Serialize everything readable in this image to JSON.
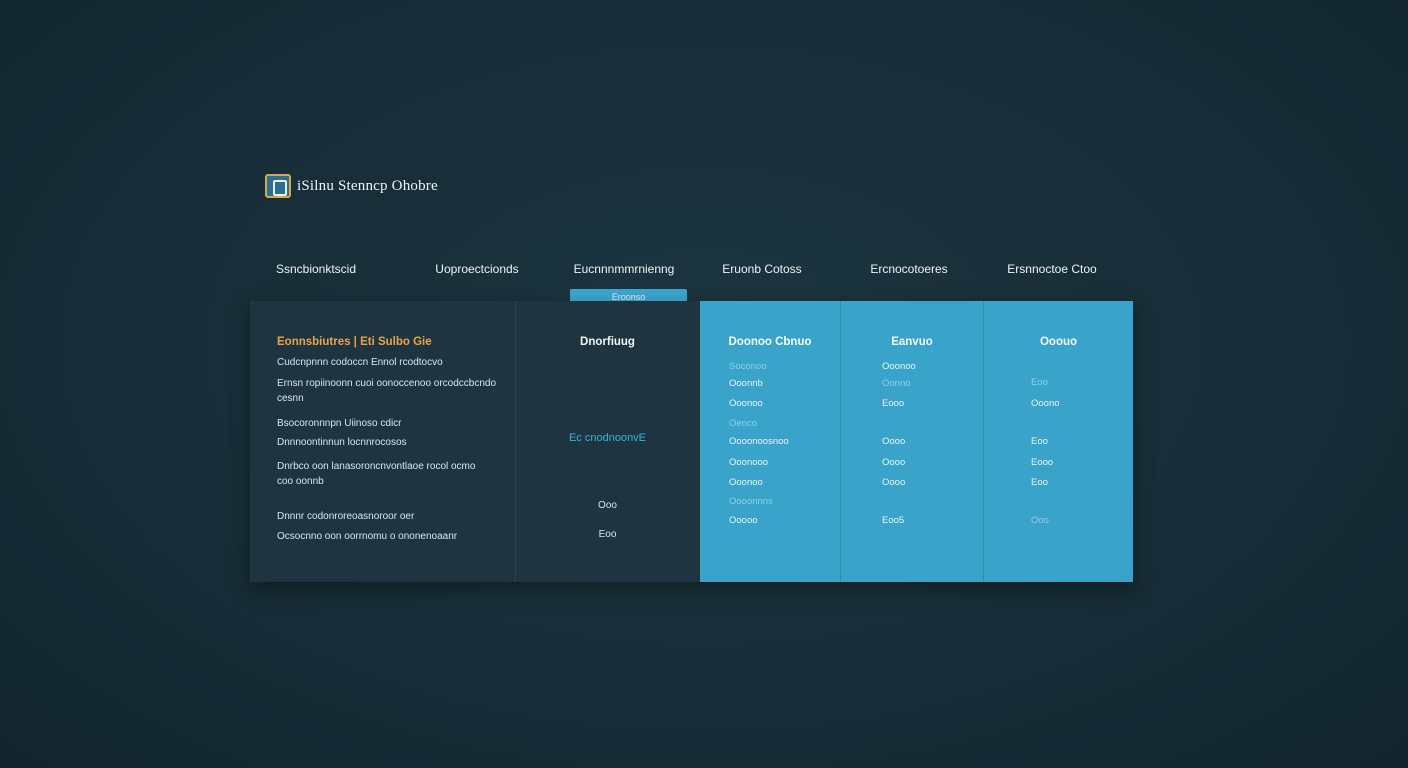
{
  "app": {
    "title": "iSilnu Stenncp Ohobre",
    "logo_icon": "app-logo-icon"
  },
  "tabs": [
    {
      "label": "Ssncbionktscid"
    },
    {
      "label": "Uoproectcionds"
    },
    {
      "label": "Eucnnnmmrnienng"
    },
    {
      "label": "Eruonb Cotoss"
    },
    {
      "label": "Ercnocotoeres"
    },
    {
      "label": "Ersnnoctoe Ctoo"
    }
  ],
  "selected_tab_badge": "Eroonso",
  "features": {
    "heading": "Eonnsbiutres  |  Eti Sulbo Gie",
    "items": [
      "Cudcnpnnn codoccn Ennol rcodtocvo",
      "Ernsn ropiinoonn cuoi oonoccenoo orcodccbcndo cesnn",
      "Bsocoronnnpn Uiinoso  cdicr",
      "Dnnnoontinnun locnnrocosos",
      "Dnrbco oon lanasoroncnvontlaoe rocol ocmo coo oonnb",
      "Dnnnr codonroreoasnoroor oer",
      "Ocsocnno oon oorrnomu o ononenoaanr"
    ]
  },
  "basic_plan": {
    "name": "Dnorfiuug",
    "highlight_prefix": "Ec cnodnoo",
    "highlight_accent": "nvE",
    "value_1": "Ooo",
    "value_2": "Eoo"
  },
  "plans": [
    {
      "name": "Doonoo Cbnuo",
      "cells": [
        {
          "text": "Soconoo",
          "dim": true
        },
        {
          "text": "Ooonnb",
          "dim": false
        },
        {
          "text": "Ooonoo",
          "dim": false
        },
        {
          "text": "Oenco",
          "dim": true
        },
        {
          "text": "Oooonoosnoo",
          "dim": false
        },
        {
          "text": "Ooonooo",
          "dim": false
        },
        {
          "text": "Ooonoo",
          "dim": false
        },
        {
          "text": "Oooonnns",
          "dim": true
        },
        {
          "text": "Ooooo",
          "dim": false
        }
      ]
    },
    {
      "name": "Eanvuo",
      "cells": [
        {
          "text": "Ooonoo",
          "dim": false
        },
        {
          "text": "Oonno",
          "dim": true
        },
        {
          "text": "Eooo",
          "dim": false
        },
        {
          "text": "Oooo",
          "dim": false
        },
        {
          "text": "Oooo",
          "dim": false
        },
        {
          "text": "Oooo",
          "dim": false
        },
        {
          "text": "Eoo5",
          "dim": false
        }
      ]
    },
    {
      "name": "Ooouo",
      "cells": [
        {
          "text": "Eoo",
          "dim": true
        },
        {
          "text": "Ooono",
          "dim": false
        },
        {
          "text": "Eoo",
          "dim": false
        },
        {
          "text": "Eooo",
          "dim": false
        },
        {
          "text": "Eoo",
          "dim": false
        },
        {
          "text": "Ooo",
          "dim": true
        }
      ]
    }
  ],
  "colors": {
    "background": "#172c36",
    "panel_dark": "#1e3541",
    "panel_blue": "#3aa3c9",
    "accent_orange": "#e9a443",
    "accent_cyan": "#39b0dc"
  }
}
